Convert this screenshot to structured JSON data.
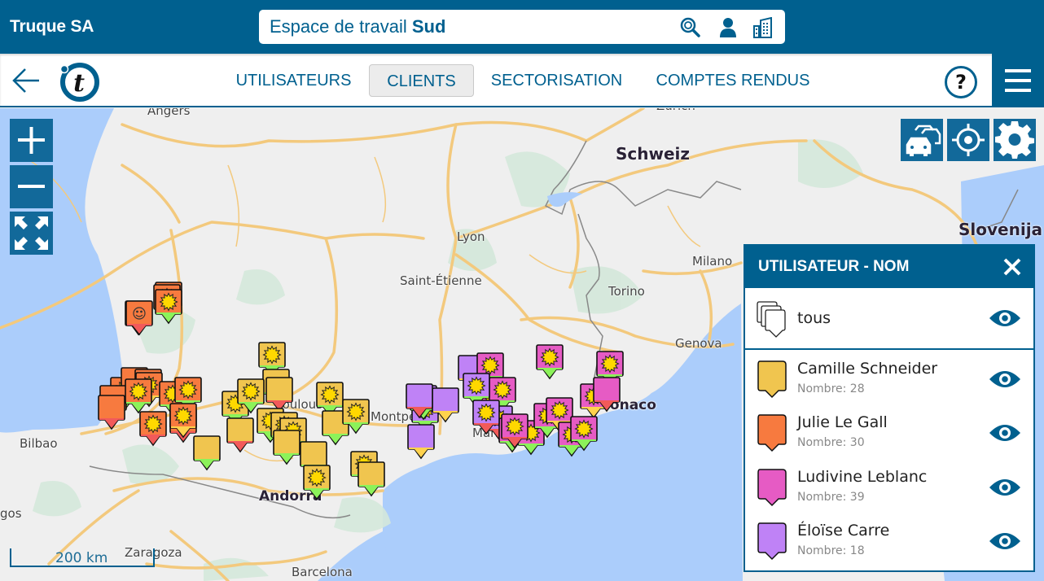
{
  "header": {
    "brand": "Truque SA",
    "workspace_prefix": "Espace de travail ",
    "workspace_name": "Sud",
    "icons": [
      "search-location-icon",
      "user-icon",
      "building-icon"
    ]
  },
  "nav": {
    "back_icon": "arrow-left-icon",
    "logo_letter": "t",
    "tabs": [
      {
        "label": "UTILISATEURS",
        "active": false
      },
      {
        "label": "CLIENTS",
        "active": true
      },
      {
        "label": "SECTORISATION",
        "active": false
      },
      {
        "label": "COMPTES RENDUS",
        "active": false
      }
    ],
    "help_label": "?",
    "menu_icon": "hamburger-icon"
  },
  "map": {
    "controls": [
      "zoom-in-icon",
      "zoom-out-icon",
      "fullscreen-icon"
    ],
    "tools": [
      "traffic-icon",
      "locate-icon",
      "gear-icon"
    ],
    "scale_label": "200 km",
    "labels": [
      {
        "text": "Angers",
        "type": "city"
      },
      {
        "text": "Zürich",
        "type": "city"
      },
      {
        "text": "Schweiz",
        "type": "country"
      },
      {
        "text": "Slovenija",
        "type": "country"
      },
      {
        "text": "Lyon",
        "type": "city"
      },
      {
        "text": "Saint-Étienne",
        "type": "city"
      },
      {
        "text": "Milano",
        "type": "city"
      },
      {
        "text": "Torino",
        "type": "city"
      },
      {
        "text": "Genova",
        "type": "city"
      },
      {
        "text": "Bilbao",
        "type": "city"
      },
      {
        "text": "gos",
        "type": "city"
      },
      {
        "text": "Zaragoza",
        "type": "city"
      },
      {
        "text": "Barcelona",
        "type": "city"
      },
      {
        "text": "Andorra",
        "type": "city-big"
      },
      {
        "text": "Montpellier",
        "type": "city"
      },
      {
        "text": "Monaco",
        "type": "city-big"
      },
      {
        "text": "Toulouse",
        "type": "city"
      },
      {
        "text": "Marseille",
        "type": "city"
      }
    ],
    "marker_colors": {
      "Camille Schneider": "#f0c54f",
      "Julie Le Gall": "#f77a3f",
      "Ludivine Leblanc": "#e65bc4",
      "Éloïse Carre": "#bf82f6"
    }
  },
  "legend": {
    "title": "UTILISATEUR - NOM",
    "close_icon": "close-icon",
    "all": {
      "label": "tous"
    },
    "users": [
      {
        "name": "Camille Schneider",
        "count_label": "Nombre: 28",
        "color": "#f0c54f"
      },
      {
        "name": "Julie Le Gall",
        "count_label": "Nombre: 30",
        "color": "#f77a3f"
      },
      {
        "name": "Ludivine Leblanc",
        "count_label": "Nombre: 39",
        "color": "#e65bc4"
      },
      {
        "name": "Éloïse Carre",
        "count_label": "Nombre: 18",
        "color": "#bf82f6"
      }
    ]
  },
  "colors": {
    "brand": "#00608f",
    "control": "#12699a",
    "water": "#abcdfb",
    "road": "#f3c97d",
    "forest": "#d4e8da",
    "status_green": "#8cf25a",
    "status_red": "#f25a5a",
    "status_yellow": "#ffd24d",
    "sun": "#ffd800"
  }
}
